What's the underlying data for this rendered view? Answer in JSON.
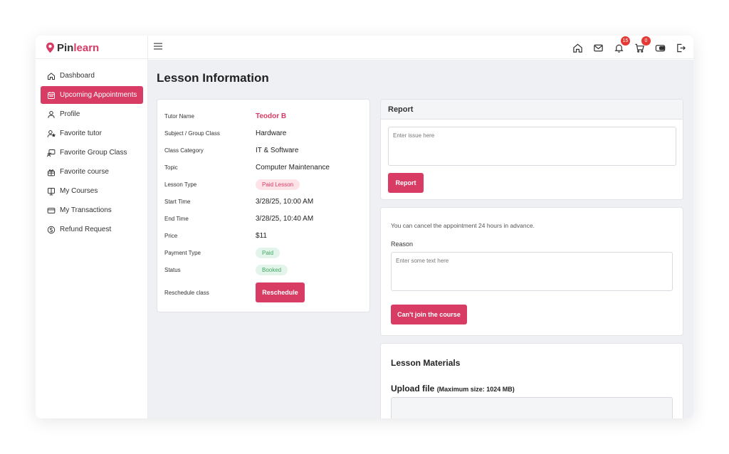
{
  "brand": {
    "pin": "Pin",
    "learn": "learn",
    "color": "#d83b63"
  },
  "header": {
    "icons": [
      "home-icon",
      "mail-icon",
      "bell-icon",
      "cart-icon",
      "wallet-icon",
      "logout-icon"
    ],
    "notifications_count": "15",
    "cart_count": "0"
  },
  "sidebar": {
    "items": [
      {
        "label": "Dashboard",
        "icon": "home-icon"
      },
      {
        "label": "Upcoming Appointments",
        "icon": "calendar-icon",
        "active": true
      },
      {
        "label": "Profile",
        "icon": "user-icon"
      },
      {
        "label": "Favorite tutor",
        "icon": "user-star-icon"
      },
      {
        "label": "Favorite Group Class",
        "icon": "presentation-icon"
      },
      {
        "label": "Favorite course",
        "icon": "gift-icon"
      },
      {
        "label": "My Courses",
        "icon": "book-icon"
      },
      {
        "label": "My Transactions",
        "icon": "card-icon"
      },
      {
        "label": "Refund Request",
        "icon": "dollar-circle-icon"
      }
    ]
  },
  "page": {
    "title": "Lesson Information"
  },
  "lesson": {
    "rows": [
      {
        "label": "Tutor Name",
        "value": "Teodor B"
      },
      {
        "label": "Subject / Group Class",
        "value": "Hardware"
      },
      {
        "label": "Class Category",
        "value": "IT & Software"
      },
      {
        "label": "Topic",
        "value": "Computer Maintenance"
      },
      {
        "label": "Lesson Type",
        "value": "Paid Lesson"
      },
      {
        "label": "Start Time",
        "value": "3/28/25, 10:00 AM"
      },
      {
        "label": "End Time",
        "value": "3/28/25, 10:40 AM"
      },
      {
        "label": "Price",
        "value": "$11"
      },
      {
        "label": "Payment Type",
        "value": "Paid"
      },
      {
        "label": "Status",
        "value": "Booked"
      },
      {
        "label": "Reschedule class",
        "value": "Reschedule"
      }
    ]
  },
  "report": {
    "title": "Report",
    "placeholder": "Enter issue here",
    "button": "Report"
  },
  "cancel": {
    "note": "You can cancel the appointment 24 hours in advance.",
    "reason_label": "Reason",
    "placeholder": "Enter some text here",
    "button": "Can't join the course"
  },
  "materials": {
    "title": "Lesson Materials",
    "upload_title": "Upload file",
    "upload_size": "(Maximum size: 1024 MB)"
  }
}
